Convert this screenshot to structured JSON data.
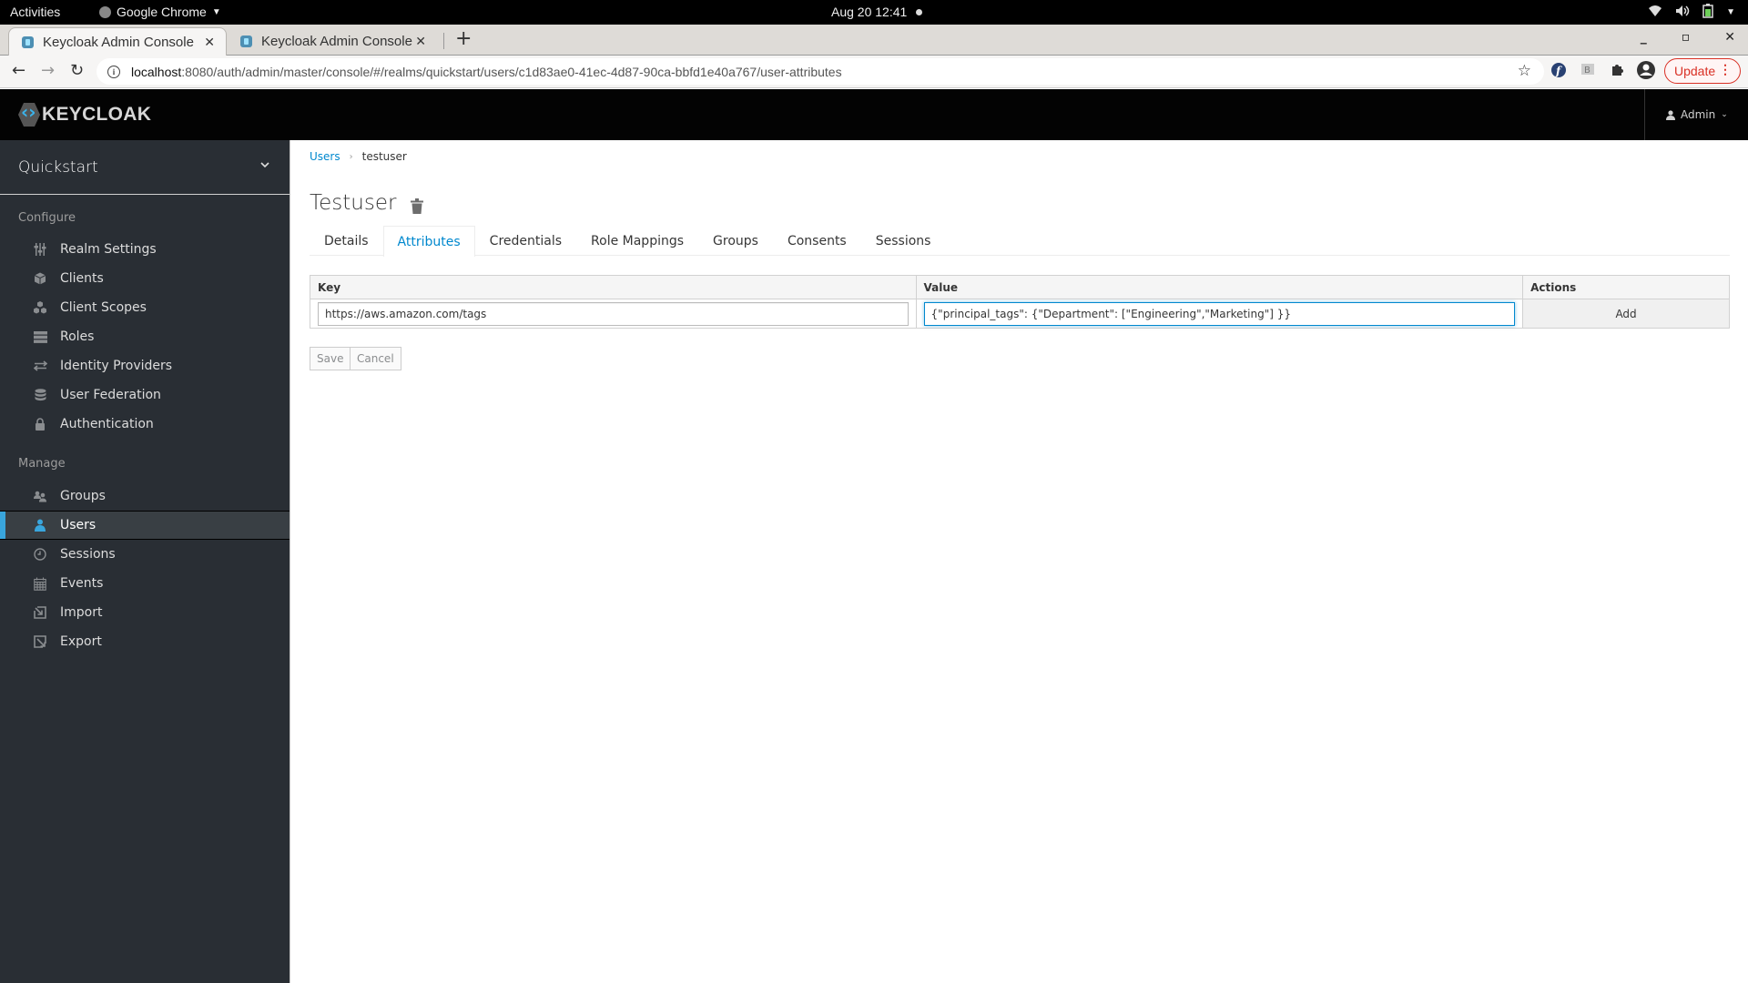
{
  "os_bar": {
    "activities": "Activities",
    "app_name": "Google Chrome",
    "clock": "Aug 20  12:41"
  },
  "browser": {
    "tabs": [
      {
        "title": "Keycloak Admin Console",
        "active": true
      },
      {
        "title": "Keycloak Admin Console",
        "active": false
      }
    ],
    "url_host": "localhost",
    "url_path": ":8080/auth/admin/master/console/#/realms/quickstart/users/c1d83ae0-41ec-4d87-90ca-bbfd1e40a767/user-attributes",
    "update_label": "Update"
  },
  "header": {
    "logo_text": "KEYCLOAK",
    "user_menu": "Admin"
  },
  "sidebar": {
    "realm": "Quickstart",
    "configure_label": "Configure",
    "configure_items": [
      {
        "label": "Realm Settings",
        "icon": "sliders-icon"
      },
      {
        "label": "Clients",
        "icon": "cube-icon"
      },
      {
        "label": "Client Scopes",
        "icon": "cubes-icon"
      },
      {
        "label": "Roles",
        "icon": "list-icon"
      },
      {
        "label": "Identity Providers",
        "icon": "exchange-icon"
      },
      {
        "label": "User Federation",
        "icon": "database-icon"
      },
      {
        "label": "Authentication",
        "icon": "lock-icon"
      }
    ],
    "manage_label": "Manage",
    "manage_items": [
      {
        "label": "Groups",
        "icon": "users-icon"
      },
      {
        "label": "Users",
        "icon": "user-icon",
        "active": true
      },
      {
        "label": "Sessions",
        "icon": "clock-icon"
      },
      {
        "label": "Events",
        "icon": "calendar-icon"
      },
      {
        "label": "Import",
        "icon": "import-icon"
      },
      {
        "label": "Export",
        "icon": "export-icon"
      }
    ]
  },
  "main": {
    "breadcrumb": {
      "parent": "Users",
      "current": "testuser"
    },
    "title": "Testuser",
    "tabs": [
      "Details",
      "Attributes",
      "Credentials",
      "Role Mappings",
      "Groups",
      "Consents",
      "Sessions"
    ],
    "active_tab": "Attributes",
    "table": {
      "headers": [
        "Key",
        "Value",
        "Actions"
      ],
      "row": {
        "key": "https://aws.amazon.com/tags",
        "value": "{\"principal_tags\": {\"Department\": [\"Engineering\",\"Marketing\"] }}",
        "action": "Add"
      }
    },
    "save_label": "Save",
    "cancel_label": "Cancel"
  },
  "colors": {
    "accent": "#0088ce",
    "active_indicator": "#39a5dc",
    "sidebar_bg": "#292e34",
    "header_bg": "#030303"
  }
}
